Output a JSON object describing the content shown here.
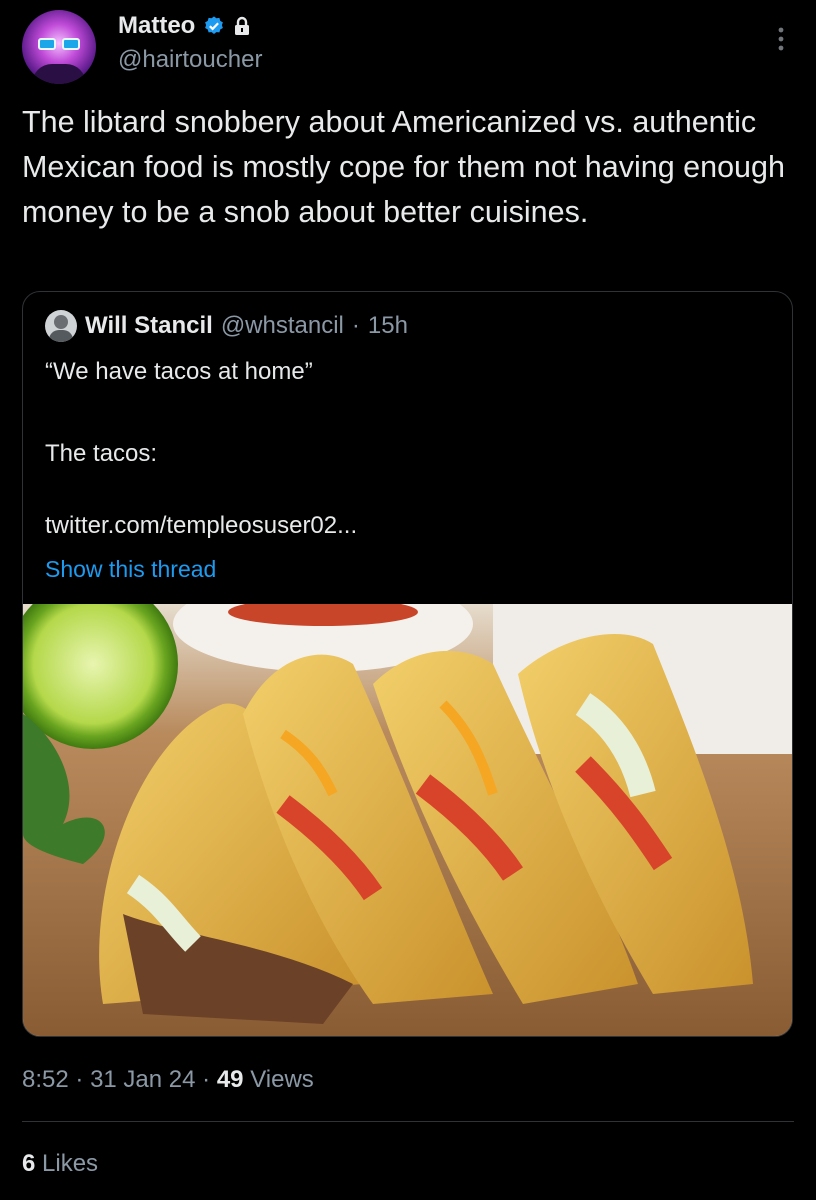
{
  "author": {
    "name": "Matteo",
    "handle": "@hairtoucher",
    "verified": true,
    "protected": true
  },
  "tweet": {
    "text": "The libtard snobbery about Americanized vs. authentic Mexican food is mostly cope for them not having enough money to be a snob about better cuisines."
  },
  "quote": {
    "name": "Will Stancil",
    "handle": "@whstancil",
    "separator": "·",
    "time": "15h",
    "line1": "“We have tacos at home”",
    "line2": "The tacos:",
    "link": "twitter.com/templeosuser02...",
    "show_thread": "Show this thread",
    "image_alt": "photo of four hard-shell tacos with cheese, lettuce and tomato"
  },
  "meta": {
    "time": "8:52",
    "date": "31 Jan 24",
    "views_count": "49",
    "views_label": "Views",
    "sep": "·"
  },
  "likes": {
    "count": "6",
    "label": "Likes"
  },
  "icons": {
    "verified": "verified-badge-icon",
    "lock": "lock-icon",
    "more": "more-vertical-icon"
  },
  "colors": {
    "background": "#000000",
    "text": "#e7e9ea",
    "muted": "#8b98a5",
    "link": "#1d9bf0",
    "border": "#2f3336"
  }
}
